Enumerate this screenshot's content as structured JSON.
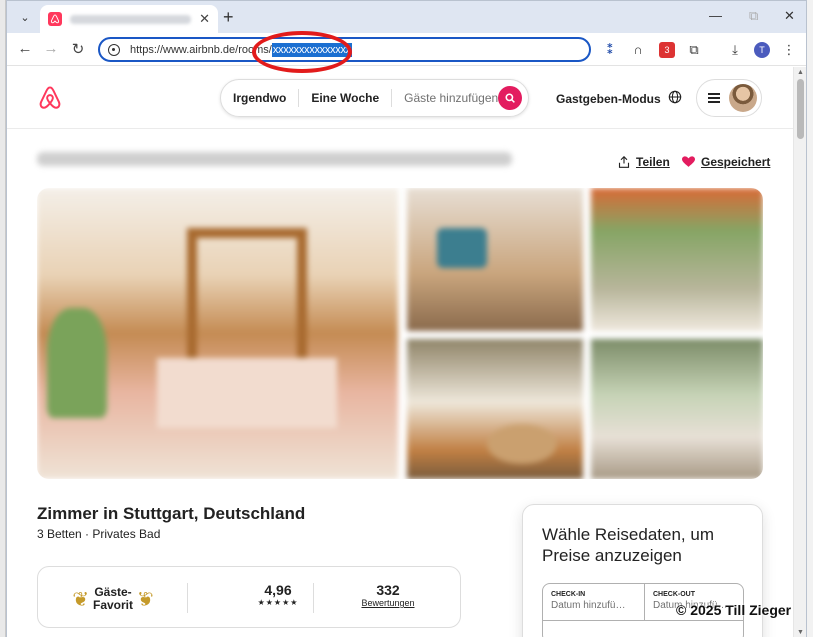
{
  "browser": {
    "url_prefix": "https://www.airbnb.de/rooms/",
    "url_selected": "xxxxxxxxxxxxxxx",
    "profile_initial": "T",
    "extension_badge": "3"
  },
  "header": {
    "search": {
      "anywhere": "Irgendwo",
      "week": "Eine Woche",
      "guests_placeholder": "Gäste hinzufügen"
    },
    "host_mode": "Gastgeben-Modus"
  },
  "listing": {
    "share": "Teilen",
    "saved": "Gespeichert",
    "title": "Zimmer in Stuttgart, Deutschland",
    "subtitle": "3 Betten · Privates Bad",
    "guest_favorite": {
      "line1": "Gäste-",
      "line2": "Favorit"
    },
    "rating": "4,96",
    "stars": "★★★★★",
    "review_count": "332",
    "review_label": "Bewertungen"
  },
  "booking": {
    "prompt": "Wähle Reisedaten, um Preise anzuzeigen",
    "checkin_label": "CHECK-IN",
    "checkin_value": "Datum hinzufü…",
    "checkout_label": "CHECK-OUT",
    "checkout_value": "Datum hinzufü…"
  },
  "watermark": "© 2025 Till Zieger",
  "colors": {
    "brand": "#ff385c",
    "search_button": "#e31c5f",
    "omnibox_focus": "#1a57c5",
    "annotation": "#e21b1b"
  }
}
